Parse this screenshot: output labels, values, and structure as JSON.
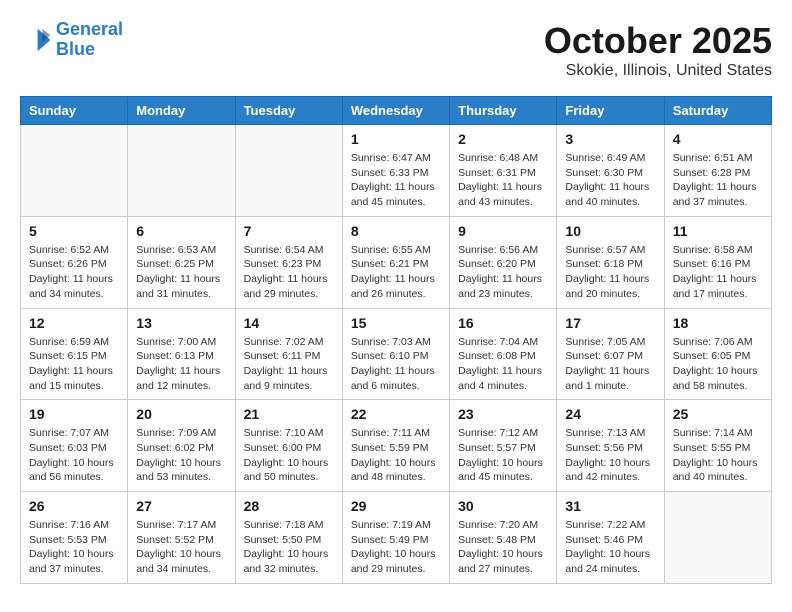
{
  "header": {
    "logo_line1": "General",
    "logo_line2": "Blue",
    "month": "October 2025",
    "location": "Skokie, Illinois, United States"
  },
  "weekdays": [
    "Sunday",
    "Monday",
    "Tuesday",
    "Wednesday",
    "Thursday",
    "Friday",
    "Saturday"
  ],
  "weeks": [
    [
      {
        "day": "",
        "info": ""
      },
      {
        "day": "",
        "info": ""
      },
      {
        "day": "",
        "info": ""
      },
      {
        "day": "1",
        "info": "Sunrise: 6:47 AM\nSunset: 6:33 PM\nDaylight: 11 hours\nand 45 minutes."
      },
      {
        "day": "2",
        "info": "Sunrise: 6:48 AM\nSunset: 6:31 PM\nDaylight: 11 hours\nand 43 minutes."
      },
      {
        "day": "3",
        "info": "Sunrise: 6:49 AM\nSunset: 6:30 PM\nDaylight: 11 hours\nand 40 minutes."
      },
      {
        "day": "4",
        "info": "Sunrise: 6:51 AM\nSunset: 6:28 PM\nDaylight: 11 hours\nand 37 minutes."
      }
    ],
    [
      {
        "day": "5",
        "info": "Sunrise: 6:52 AM\nSunset: 6:26 PM\nDaylight: 11 hours\nand 34 minutes."
      },
      {
        "day": "6",
        "info": "Sunrise: 6:53 AM\nSunset: 6:25 PM\nDaylight: 11 hours\nand 31 minutes."
      },
      {
        "day": "7",
        "info": "Sunrise: 6:54 AM\nSunset: 6:23 PM\nDaylight: 11 hours\nand 29 minutes."
      },
      {
        "day": "8",
        "info": "Sunrise: 6:55 AM\nSunset: 6:21 PM\nDaylight: 11 hours\nand 26 minutes."
      },
      {
        "day": "9",
        "info": "Sunrise: 6:56 AM\nSunset: 6:20 PM\nDaylight: 11 hours\nand 23 minutes."
      },
      {
        "day": "10",
        "info": "Sunrise: 6:57 AM\nSunset: 6:18 PM\nDaylight: 11 hours\nand 20 minutes."
      },
      {
        "day": "11",
        "info": "Sunrise: 6:58 AM\nSunset: 6:16 PM\nDaylight: 11 hours\nand 17 minutes."
      }
    ],
    [
      {
        "day": "12",
        "info": "Sunrise: 6:59 AM\nSunset: 6:15 PM\nDaylight: 11 hours\nand 15 minutes."
      },
      {
        "day": "13",
        "info": "Sunrise: 7:00 AM\nSunset: 6:13 PM\nDaylight: 11 hours\nand 12 minutes."
      },
      {
        "day": "14",
        "info": "Sunrise: 7:02 AM\nSunset: 6:11 PM\nDaylight: 11 hours\nand 9 minutes."
      },
      {
        "day": "15",
        "info": "Sunrise: 7:03 AM\nSunset: 6:10 PM\nDaylight: 11 hours\nand 6 minutes."
      },
      {
        "day": "16",
        "info": "Sunrise: 7:04 AM\nSunset: 6:08 PM\nDaylight: 11 hours\nand 4 minutes."
      },
      {
        "day": "17",
        "info": "Sunrise: 7:05 AM\nSunset: 6:07 PM\nDaylight: 11 hours\nand 1 minute."
      },
      {
        "day": "18",
        "info": "Sunrise: 7:06 AM\nSunset: 6:05 PM\nDaylight: 10 hours\nand 58 minutes."
      }
    ],
    [
      {
        "day": "19",
        "info": "Sunrise: 7:07 AM\nSunset: 6:03 PM\nDaylight: 10 hours\nand 56 minutes."
      },
      {
        "day": "20",
        "info": "Sunrise: 7:09 AM\nSunset: 6:02 PM\nDaylight: 10 hours\nand 53 minutes."
      },
      {
        "day": "21",
        "info": "Sunrise: 7:10 AM\nSunset: 6:00 PM\nDaylight: 10 hours\nand 50 minutes."
      },
      {
        "day": "22",
        "info": "Sunrise: 7:11 AM\nSunset: 5:59 PM\nDaylight: 10 hours\nand 48 minutes."
      },
      {
        "day": "23",
        "info": "Sunrise: 7:12 AM\nSunset: 5:57 PM\nDaylight: 10 hours\nand 45 minutes."
      },
      {
        "day": "24",
        "info": "Sunrise: 7:13 AM\nSunset: 5:56 PM\nDaylight: 10 hours\nand 42 minutes."
      },
      {
        "day": "25",
        "info": "Sunrise: 7:14 AM\nSunset: 5:55 PM\nDaylight: 10 hours\nand 40 minutes."
      }
    ],
    [
      {
        "day": "26",
        "info": "Sunrise: 7:16 AM\nSunset: 5:53 PM\nDaylight: 10 hours\nand 37 minutes."
      },
      {
        "day": "27",
        "info": "Sunrise: 7:17 AM\nSunset: 5:52 PM\nDaylight: 10 hours\nand 34 minutes."
      },
      {
        "day": "28",
        "info": "Sunrise: 7:18 AM\nSunset: 5:50 PM\nDaylight: 10 hours\nand 32 minutes."
      },
      {
        "day": "29",
        "info": "Sunrise: 7:19 AM\nSunset: 5:49 PM\nDaylight: 10 hours\nand 29 minutes."
      },
      {
        "day": "30",
        "info": "Sunrise: 7:20 AM\nSunset: 5:48 PM\nDaylight: 10 hours\nand 27 minutes."
      },
      {
        "day": "31",
        "info": "Sunrise: 7:22 AM\nSunset: 5:46 PM\nDaylight: 10 hours\nand 24 minutes."
      },
      {
        "day": "",
        "info": ""
      }
    ]
  ]
}
